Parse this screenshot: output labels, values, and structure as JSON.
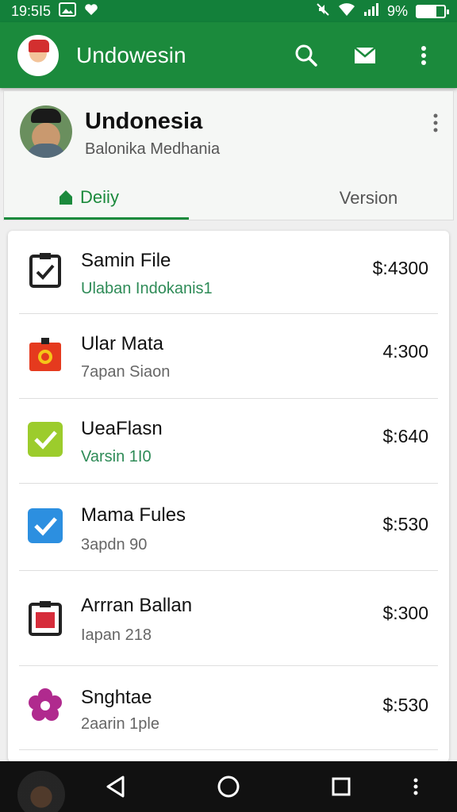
{
  "status_bar": {
    "time": "19:5I5",
    "battery_text": "9%",
    "battery_level": 0.7
  },
  "app_bar": {
    "title": "Undowesin",
    "actions": [
      "search-icon",
      "mail-icon",
      "more-vert-icon"
    ]
  },
  "profile": {
    "name": "Undonesia",
    "subtitle": "Balonika Medhania",
    "tabs": [
      {
        "label": "Deiiy",
        "icon": "home-icon",
        "active": true
      },
      {
        "label": "Version",
        "active": false
      }
    ]
  },
  "list": {
    "items": [
      {
        "title": "Samin File",
        "subtitle": "Ulaban Indokanis1",
        "price": "$:4300",
        "icon": "clipboard-check-icon",
        "subtitle_color": "#2e8b57"
      },
      {
        "title": "Ular Mata",
        "subtitle": "7apan Siaon",
        "price": "4:300",
        "icon": "shopping-bag-icon",
        "subtitle_color": "#666666"
      },
      {
        "title": "UeaFlasn",
        "subtitle": "Varsin 1I0",
        "price": "$:640",
        "icon": "green-check-icon",
        "subtitle_color": "#2e8b57"
      },
      {
        "title": "Mama Fules",
        "subtitle": "3apdn 90",
        "price": "$:530",
        "icon": "blue-check-icon",
        "subtitle_color": "#666666"
      },
      {
        "title": "Arrran Ballan",
        "subtitle": "Iapan 218",
        "price": "$:300",
        "icon": "red-clipboard-icon",
        "subtitle_color": "#666666"
      },
      {
        "title": "Snghtae",
        "subtitle": "2aarin 1ple",
        "price": "$:530",
        "icon": "flower-icon",
        "subtitle_color": "#666666"
      }
    ]
  },
  "colors": {
    "primary": "#1b8a3c",
    "status_bar": "#13803a"
  }
}
